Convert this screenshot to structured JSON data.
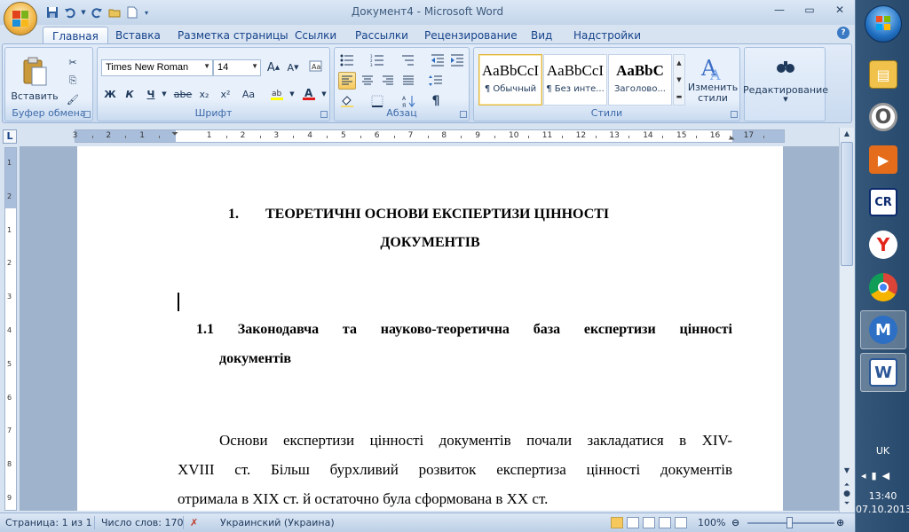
{
  "window": {
    "title": "Документ4 - Microsoft Word",
    "controls": {
      "minimize": "—",
      "maximize": "▭",
      "close": "✕"
    }
  },
  "qat": {
    "save_icon": "save-icon",
    "undo_icon": "undo-icon",
    "redo_icon": "redo-icon"
  },
  "tabs": [
    "Главная",
    "Вставка",
    "Разметка страницы",
    "Ссылки",
    "Рассылки",
    "Рецензирование",
    "Вид",
    "Надстройки"
  ],
  "active_tab": "Главная",
  "ribbon": {
    "clipboard": {
      "label": "Буфер обмена",
      "paste": "Вставить"
    },
    "font": {
      "label": "Шрифт",
      "name": "Times New Roman",
      "size": "14",
      "bold": "Ж",
      "italic": "К",
      "underline": "Ч",
      "strike": "abe",
      "sub": "x₂",
      "sup": "x²",
      "case": "Aa"
    },
    "paragraph": {
      "label": "Абзац"
    },
    "styles": {
      "label": "Стили",
      "items": [
        {
          "sample": "AaBbCcI",
          "name": "¶ Обычный"
        },
        {
          "sample": "AaBbCcI",
          "name": "¶ Без инте..."
        },
        {
          "sample": "AaBbC",
          "name": "Заголово..."
        }
      ],
      "change": "Изменить стили"
    },
    "editing": {
      "label": "Редактирование"
    }
  },
  "ruler": {
    "numbers": [
      "3",
      "2",
      "1",
      "1",
      "2",
      "3",
      "4",
      "5",
      "6",
      "7",
      "8",
      "9",
      "10",
      "11",
      "12",
      "13",
      "14",
      "15",
      "16",
      "17"
    ],
    "vertical_numbers": [
      "1",
      "2",
      "1",
      "2",
      "3",
      "4",
      "5",
      "6",
      "7",
      "8",
      "9"
    ]
  },
  "document": {
    "heading1_number": "1.",
    "heading1_line1": "ТЕОРЕТИЧНІ ОСНОВИ ЕКСПЕРТИЗИ ЦІННОСТІ",
    "heading1_line2": "ДОКУМЕНТІВ",
    "heading2_words": [
      "1.1",
      "Законодавча",
      "та",
      "науково-теоретична",
      "база",
      "експертизи",
      "цінності"
    ],
    "heading2_line2": "документів",
    "para_line1": [
      "Основи",
      "експертизи",
      "цінності",
      "документів",
      "почали",
      "закладатися",
      "в",
      "XIV-"
    ],
    "para_line2": [
      "XVIII",
      "ст.",
      "Більш",
      "бурхливий",
      "розвиток",
      "експертиза",
      "цінності",
      "документів"
    ],
    "para_line3": "отримала в XIX ст. й остаточно була сформована в XX ст."
  },
  "status": {
    "page": "Страница: 1 из 1",
    "words": "Число слов: 170",
    "language": "Украинский (Украина)",
    "zoom": "100%"
  },
  "taskbar": {
    "lang": "UK",
    "time": "13:40",
    "date": "07.10.2013",
    "apps": [
      "explorer-icon",
      "opera-icon",
      "media-player-icon",
      "total-commander-icon",
      "yandex-browser-icon",
      "chrome-icon",
      "maxthon-icon",
      "word-icon"
    ]
  },
  "colors": {
    "accent": "#15428b",
    "ribbon": "#d7e3f1",
    "page_bg": "#9fb3cc"
  }
}
